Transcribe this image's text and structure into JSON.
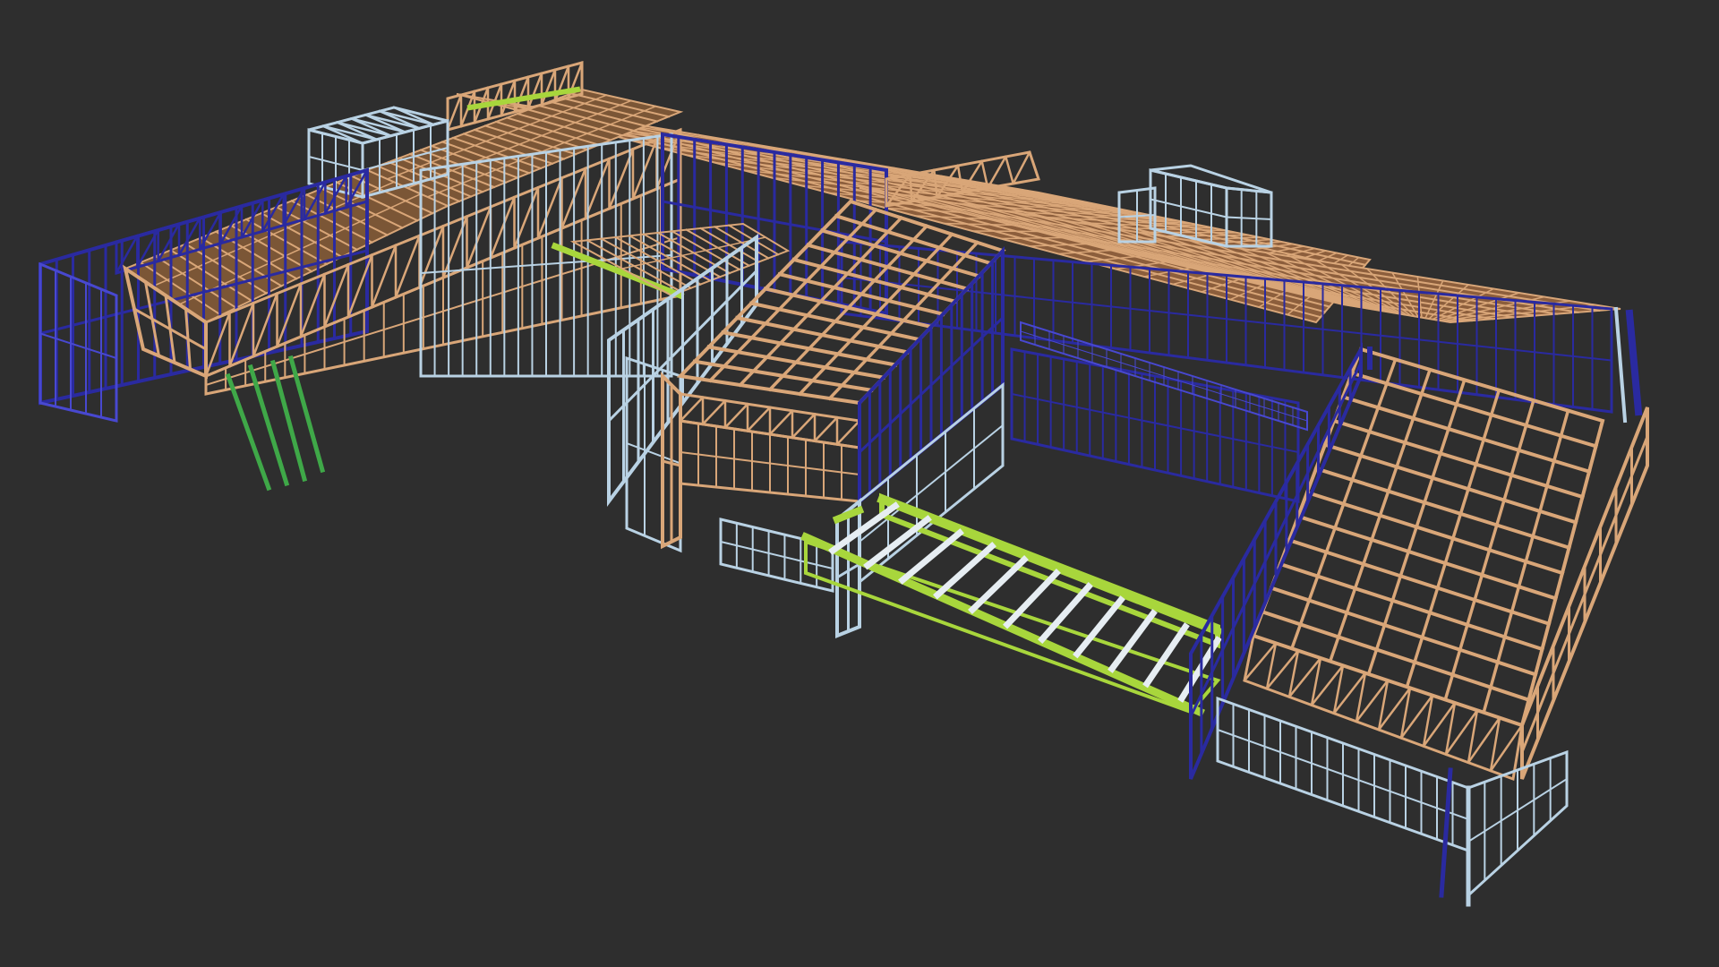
{
  "viewport": {
    "background": "#2e2e2e",
    "description_icon": "3d-model-viewport-icon"
  },
  "palette": {
    "timber": "#d9a678",
    "timber_dark": "#b07a52",
    "steel_blue": "#2a2aa0",
    "steel_blue_light": "#4848d0",
    "light_steel": "#b9d2e4",
    "joist_green": "#a8d63c",
    "column_green": "#3fa848",
    "deck_brown": "#9e6a44"
  },
  "model_parts": [
    "left-wall-frame",
    "left-roof-truss",
    "green-columns",
    "upper-roof-deck",
    "rear-light-steel-tower",
    "right-light-steel-tower",
    "central-blue-wall",
    "central-pitched-roof",
    "front-green-joist-deck",
    "right-pitched-roof",
    "right-lower-frame",
    "long-roof-deck"
  ]
}
